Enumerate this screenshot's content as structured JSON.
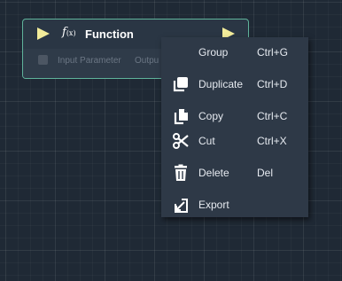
{
  "node": {
    "title": "Function",
    "icon": "function-icon",
    "pins": {
      "input_label": "Input Parameter",
      "output_label": "Outpu"
    }
  },
  "context_menu": {
    "items": [
      {
        "label": "Group",
        "shortcut": "Ctrl+G",
        "icon": ""
      },
      {
        "label": "Duplicate",
        "shortcut": "Ctrl+D",
        "icon": "duplicate-icon"
      },
      {
        "label": "Copy",
        "shortcut": "Ctrl+C",
        "icon": "copy-icon"
      },
      {
        "label": "Cut",
        "shortcut": "Ctrl+X",
        "icon": "scissors-icon"
      },
      {
        "label": "Delete",
        "shortcut": "Del",
        "icon": "trash-icon"
      },
      {
        "label": "Export",
        "shortcut": "",
        "icon": "export-icon"
      }
    ]
  },
  "colors": {
    "canvas_bg": "#1f2935",
    "node_border": "#5fb39b",
    "exec_pin": "#f2ec9a",
    "menu_bg": "#2e3947"
  }
}
